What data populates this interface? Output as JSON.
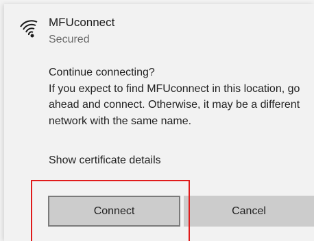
{
  "network": {
    "name": "MFUconnect",
    "status": "Secured",
    "icon": "wifi-secured-icon"
  },
  "dialog": {
    "question": "Continue connecting?",
    "body": "If you expect to find MFUconnect in this location, go ahead and connect. Otherwise, it may be a different network with the same name.",
    "cert_link": "Show certificate details"
  },
  "buttons": {
    "connect_label": "Connect",
    "cancel_label": "Cancel"
  },
  "colors": {
    "panel_bg": "#f2f2f2",
    "button_bg": "#cccccc",
    "button_border": "#7a7a7a",
    "highlight": "#e01b1b",
    "secondary_text": "#6b6b6b"
  }
}
